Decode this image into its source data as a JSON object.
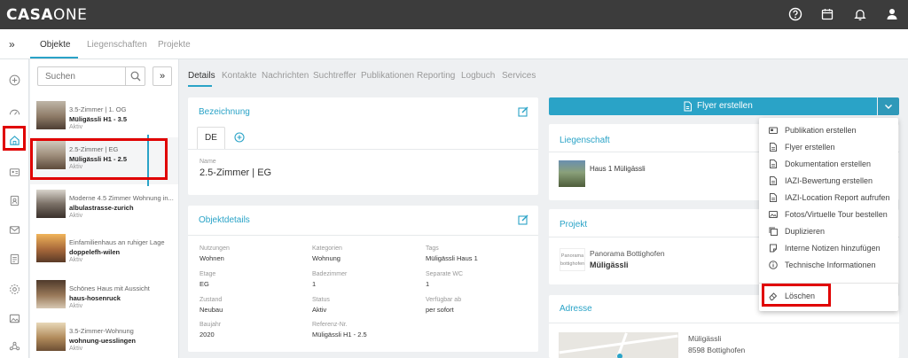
{
  "app": {
    "logo_bold": "CASA",
    "logo_light": "ONE"
  },
  "subnav": {
    "expand": "»",
    "tabs": [
      {
        "label": "Objekte",
        "active": true
      },
      {
        "label": "Liegenschaften",
        "active": false
      },
      {
        "label": "Projekte",
        "active": false
      }
    ]
  },
  "search": {
    "placeholder": "Suchen",
    "expand": "»"
  },
  "list": [
    {
      "sub": "3.5-Zimmer | 1. OG",
      "title": "Müligässli H1 - 3.5",
      "status": "Aktiv"
    },
    {
      "sub": "2.5-Zimmer | EG",
      "title": "Müligässli H1 - 2.5",
      "status": "Aktiv"
    },
    {
      "sub": "Moderne 4.5 Zimmer Wohnung in...",
      "title": "albulastrasse-zurich",
      "status": "Aktiv"
    },
    {
      "sub": "Einfamilienhaus an ruhiger Lage",
      "title": "doppelefh-wilen",
      "status": "Aktiv"
    },
    {
      "sub": "Schönes Haus mit Aussicht",
      "title": "haus-hosenruck",
      "status": "Aktiv"
    },
    {
      "sub": "3.5-Zimmer-Wohnung",
      "title": "wohnung-uesslingen",
      "status": "Aktiv"
    }
  ],
  "detail_tabs": [
    "Details",
    "Kontakte",
    "Nachrichten",
    "Suchtreffer",
    "Publikationen",
    "Reporting",
    "Logbuch",
    "Services"
  ],
  "bezeichnung": {
    "title": "Bezeichnung",
    "lang": "DE",
    "name_label": "Name",
    "name_value": "2.5-Zimmer | EG"
  },
  "objektdetails": {
    "title": "Objektdetails",
    "fields": [
      {
        "label": "Nutzungen",
        "value": "Wohnen"
      },
      {
        "label": "Kategorien",
        "value": "Wohnung"
      },
      {
        "label": "Tags",
        "value": "Müligässli Haus 1"
      },
      {
        "label": "Etage",
        "value": "EG"
      },
      {
        "label": "Badezimmer",
        "value": "1"
      },
      {
        "label": "Separate WC",
        "value": "1"
      },
      {
        "label": "Zustand",
        "value": "Neubau"
      },
      {
        "label": "Status",
        "value": "Aktiv"
      },
      {
        "label": "Verfügbar ab",
        "value": "per sofort"
      },
      {
        "label": "Baujahr",
        "value": "2020"
      },
      {
        "label": "Referenz-Nr.",
        "value": "Müligässli H1 - 2.5"
      }
    ]
  },
  "flyer": {
    "label": "Flyer erstellen"
  },
  "liegenschaft": {
    "title": "Liegenschaft",
    "name": "Haus 1 Müligässli"
  },
  "projekt": {
    "title": "Projekt",
    "sub": "Panorama Bottighofen",
    "name": "Müligässli",
    "logo_text": "Panorama bottighofen"
  },
  "adresse": {
    "title": "Adresse",
    "street": "Müligässli",
    "city": "8598 Bottighofen"
  },
  "menu": {
    "items": [
      {
        "label": "Publikation erstellen",
        "icon": "publication-icon"
      },
      {
        "label": "Flyer erstellen",
        "icon": "file-icon"
      },
      {
        "label": "Dokumentation erstellen",
        "icon": "file-icon"
      },
      {
        "label": "IAZI-Bewertung erstellen",
        "icon": "file-icon"
      },
      {
        "label": "IAZI-Location Report aufrufen",
        "icon": "file-icon"
      },
      {
        "label": "Fotos/Virtuelle Tour bestellen",
        "icon": "image-icon"
      },
      {
        "label": "Duplizieren",
        "icon": "copy-icon"
      },
      {
        "label": "Interne Notizen hinzufügen",
        "icon": "note-icon"
      },
      {
        "label": "Technische Informationen",
        "icon": "info-icon"
      }
    ],
    "delete_label": "Löschen"
  },
  "colors": {
    "accent": "#2aa3c7",
    "topbar": "#3c3c3c",
    "highlight": "#e00000"
  }
}
